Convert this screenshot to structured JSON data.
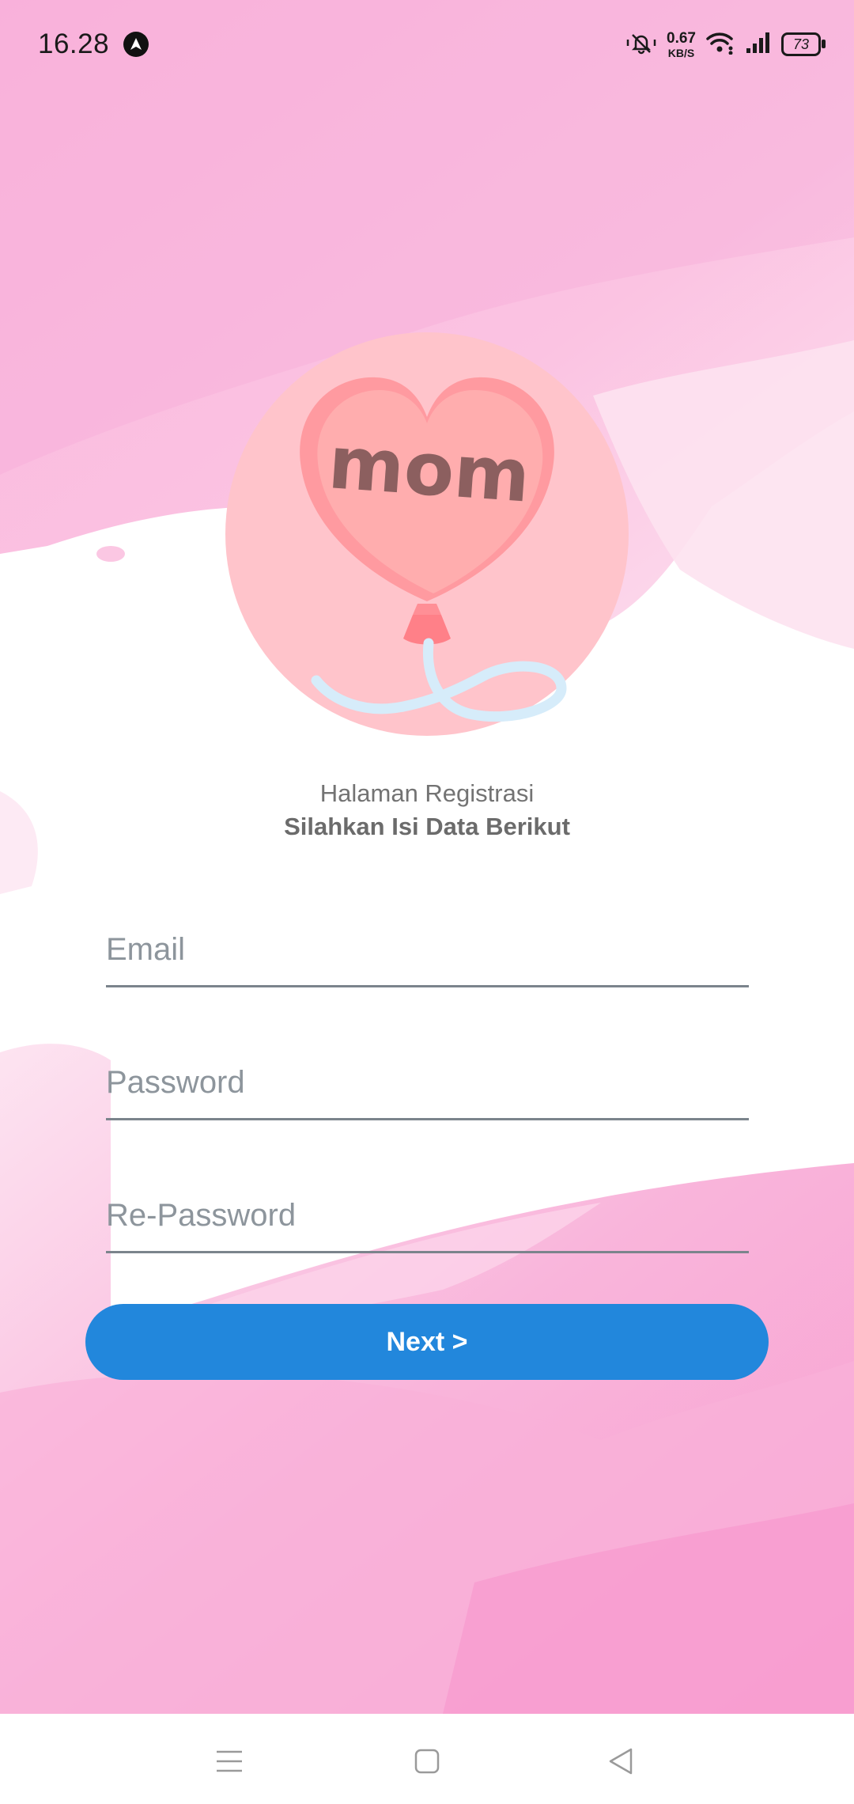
{
  "status_bar": {
    "time": "16.28",
    "net_speed_value": "0.67",
    "net_speed_unit": "KB/S",
    "battery": "73"
  },
  "header": {
    "subtitle": "Halaman Registrasi",
    "title": "Silahkan Isi Data Berikut"
  },
  "logo": {
    "text": "mom"
  },
  "form": {
    "email_placeholder": "Email",
    "password_placeholder": "Password",
    "repassword_placeholder": "Re-Password",
    "next_label": "Next >"
  },
  "colors": {
    "accent": "#2287dc",
    "background_pink": "#f9b3dc",
    "heart": "#ffa9aa",
    "circle": "#ffc4cb"
  },
  "icons": {
    "status": [
      "navigation-app-icon",
      "mute-vibrate-icon",
      "wifi-icon",
      "signal-icon",
      "battery-icon"
    ],
    "nav": [
      "menu-icon",
      "home-icon",
      "back-icon"
    ]
  }
}
